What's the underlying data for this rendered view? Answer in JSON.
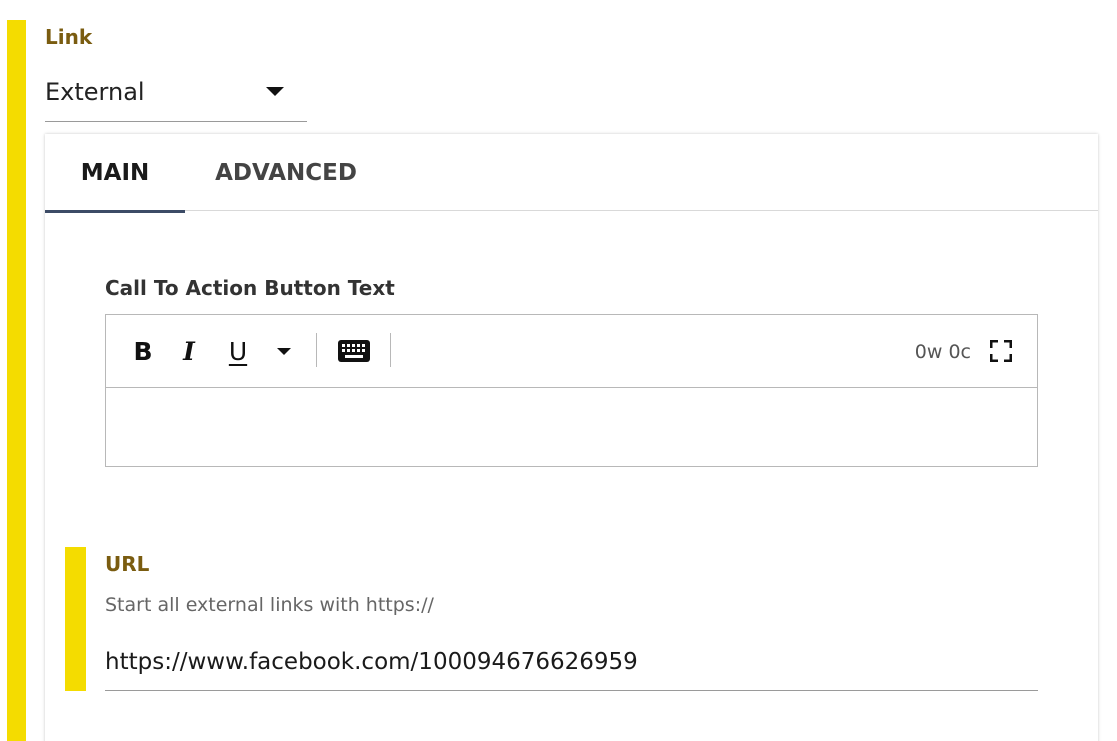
{
  "link_field": {
    "label": "Link",
    "select_value": "External"
  },
  "tabs": [
    {
      "label": "MAIN",
      "active": true
    },
    {
      "label": "ADVANCED",
      "active": false
    }
  ],
  "cta": {
    "label": "Call To Action Button Text",
    "editor": {
      "toolbar": {
        "bold": "B",
        "italic": "I",
        "underline": "U",
        "counter": "0w 0c"
      },
      "content": ""
    }
  },
  "url_field": {
    "label": "URL",
    "hint": "Start all external links with https://",
    "value": "https://www.facebook.com/100094676626959"
  },
  "colors": {
    "accent_yellow": "#f4dc00",
    "label_brown": "#7a5c10",
    "tab_indicator": "#3c4b66"
  },
  "icons": {
    "select_caret": "chevron-down-icon",
    "more_formats": "chevron-down-icon",
    "keyboard": "keyboard-icon",
    "fullscreen": "fullscreen-icon"
  }
}
